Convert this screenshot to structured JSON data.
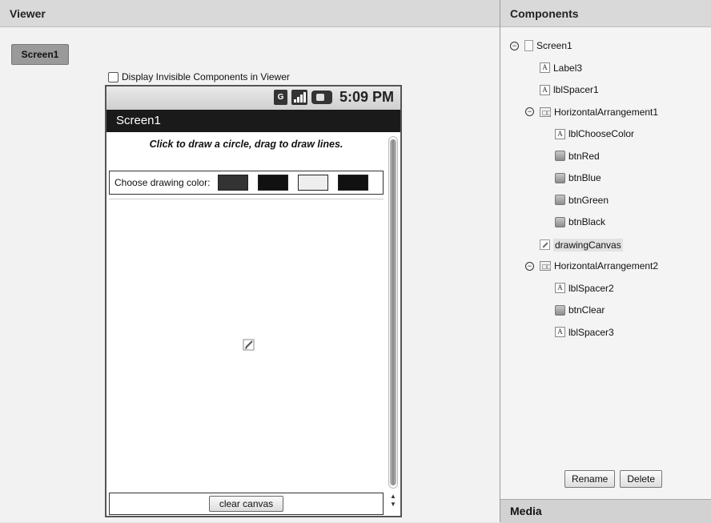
{
  "viewer": {
    "header": "Viewer",
    "screen_tab": "Screen1",
    "display_invisible_label": "Display Invisible Components in Viewer"
  },
  "phone": {
    "status": {
      "network": "G",
      "time": "5:09 PM"
    },
    "title": "Screen1",
    "label3_text": "Click to draw a circle, drag to draw lines.",
    "choose_color_label": "Choose drawing color:",
    "color_buttons": [
      {
        "name": "btnRed",
        "color": "#333333"
      },
      {
        "name": "btnBlue",
        "color": "#111111"
      },
      {
        "name": "btnGreen",
        "color": "#eeeeee"
      },
      {
        "name": "btnBlack",
        "color": "#111111"
      }
    ],
    "clear_button": "clear canvas"
  },
  "components": {
    "header": "Components",
    "tree": [
      {
        "label": "Screen1",
        "icon": "screen-icon",
        "toggle": "⊖",
        "level": 0
      },
      {
        "label": "Label3",
        "icon": "label-icon",
        "level": 1
      },
      {
        "label": "lblSpacer1",
        "icon": "label-icon",
        "level": 1
      },
      {
        "label": "HorizontalArrangement1",
        "icon": "arrangement-icon",
        "toggle": "⊖",
        "level": 1
      },
      {
        "label": "lblChooseColor",
        "icon": "label-icon",
        "level": 2
      },
      {
        "label": "btnRed",
        "icon": "button-icon",
        "level": 2
      },
      {
        "label": "btnBlue",
        "icon": "button-icon",
        "level": 2
      },
      {
        "label": "btnGreen",
        "icon": "button-icon",
        "level": 2
      },
      {
        "label": "btnBlack",
        "icon": "button-icon",
        "level": 2
      },
      {
        "label": "drawingCanvas",
        "icon": "canvas-icon",
        "level": 1,
        "selected": true
      },
      {
        "label": "HorizontalArrangement2",
        "icon": "arrangement-icon",
        "toggle": "⊖",
        "level": 1
      },
      {
        "label": "lblSpacer2",
        "icon": "label-icon",
        "level": 2
      },
      {
        "label": "btnClear",
        "icon": "button-icon",
        "level": 2
      },
      {
        "label": "lblSpacer3",
        "icon": "label-icon",
        "level": 2
      }
    ],
    "rename_button": "Rename",
    "delete_button": "Delete"
  },
  "media": {
    "header": "Media"
  }
}
